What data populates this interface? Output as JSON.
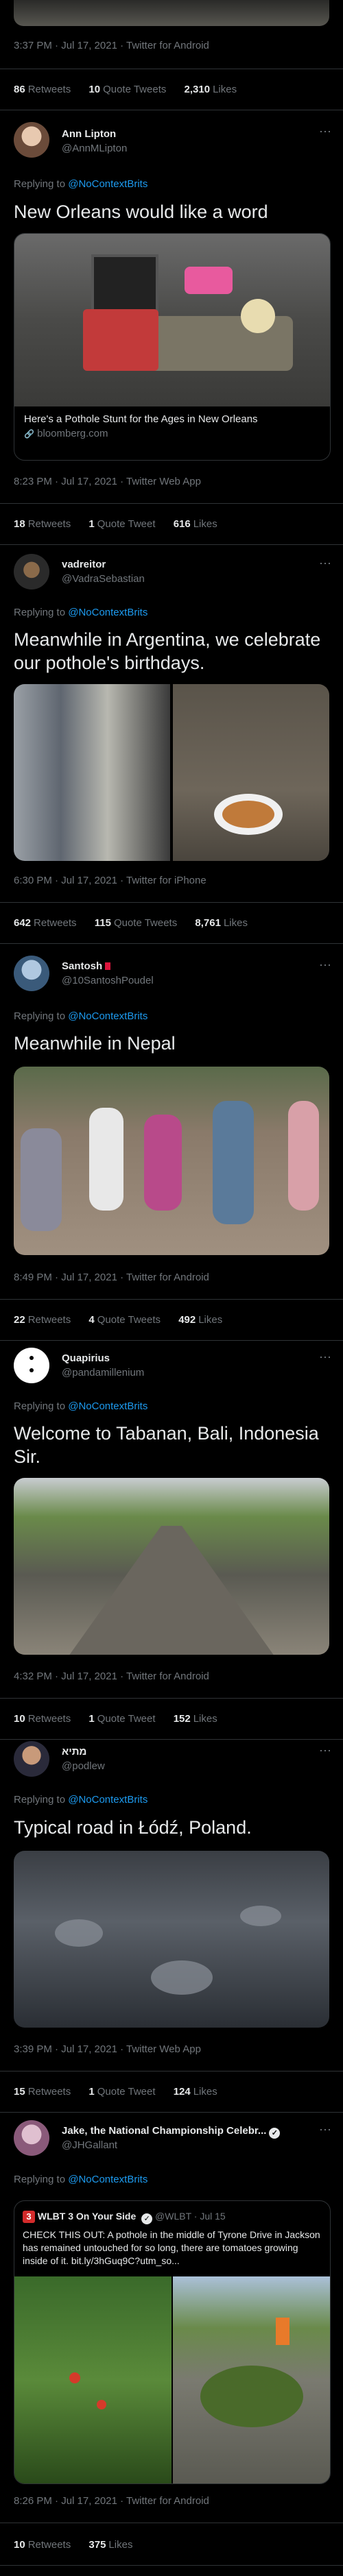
{
  "tweets_top": {
    "meta": "3:37 PM · Jul 17, 2021 · Twitter for Android",
    "retweets": "86",
    "retweets_label": "Retweets",
    "quotes": "10",
    "quotes_label": "Quote Tweets",
    "likes": "2,310",
    "likes_label": "Likes"
  },
  "tweet1": {
    "name": "Ann Lipton",
    "handle": "@AnnMLipton",
    "reply_prefix": "Replying to ",
    "reply_to": "@NoContextBrits",
    "text": "New Orleans would like a word",
    "card_title": "Here's a Pothole Stunt for the Ages in New Orleans",
    "card_domain": "bloomberg.com",
    "meta": "8:23 PM · Jul 17, 2021 · Twitter Web App",
    "retweets": "18",
    "quotes": "1",
    "quotes_label": "Quote Tweet",
    "likes": "616",
    "retweets_label": "Retweets",
    "likes_label": "Likes"
  },
  "tweet2": {
    "name": "vadreitor",
    "handle": "@VadraSebastian",
    "reply_prefix": "Replying to ",
    "reply_to": "@NoContextBrits",
    "text": "Meanwhile in Argentina, we celebrate our pothole's birthdays.",
    "meta": "6:30 PM · Jul 17, 2021 · Twitter for iPhone",
    "retweets": "642",
    "quotes": "115",
    "quotes_label": "Quote Tweets",
    "likes": "8,761",
    "retweets_label": "Retweets",
    "likes_label": "Likes"
  },
  "tweet3": {
    "name": "Santosh",
    "handle": "@10SantoshPoudel",
    "reply_prefix": "Replying to ",
    "reply_to": "@NoContextBrits",
    "text": "Meanwhile in Nepal",
    "meta": "8:49 PM · Jul 17, 2021 · Twitter for Android",
    "retweets": "22",
    "quotes": "4",
    "quotes_label": "Quote Tweets",
    "likes": "492",
    "retweets_label": "Retweets",
    "likes_label": "Likes"
  },
  "tweet4": {
    "name": "Quapirius",
    "handle": "@pandamillenium",
    "reply_prefix": "Replying to ",
    "reply_to": "@NoContextBrits",
    "text": "Welcome to Tabanan,  Bali, Indonesia Sir.",
    "meta": "4:32 PM · Jul 17, 2021 · Twitter for Android",
    "retweets": "10",
    "quotes": "1",
    "quotes_label": "Quote Tweet",
    "likes": "152",
    "retweets_label": "Retweets",
    "likes_label": "Likes"
  },
  "tweet5": {
    "name": "מתיא",
    "handle": "@podlew",
    "reply_prefix": "Replying to ",
    "reply_to": "@NoContextBrits",
    "text": "Typical road in Łódź, Poland.",
    "meta": "3:39 PM · Jul 17, 2021 · Twitter Web App",
    "retweets": "15",
    "quotes": "1",
    "quotes_label": "Quote Tweet",
    "likes": "124",
    "retweets_label": "Retweets",
    "likes_label": "Likes"
  },
  "tweet6": {
    "name": "Jake, the National Championship Celebr...",
    "handle": "@JHGallant",
    "reply_prefix": "Replying to ",
    "reply_to": "@NoContextBrits",
    "quote_badge": "3",
    "quote_name": "WLBT 3 On Your Side",
    "quote_handle_date": "@WLBT · Jul 15",
    "quote_text": "CHECK THIS OUT: A pothole in the middle of Tyrone Drive in Jackson has remained untouched for so long, there are tomatoes growing inside of it. bit.ly/3hGuq9C?utm_so...",
    "meta": "8:26 PM · Jul 17, 2021 · Twitter for Android",
    "retweets": "10",
    "likes": "375",
    "retweets_label": "Retweets",
    "likes_label": "Likes"
  },
  "icons": {
    "more": "⋯",
    "link": "🔗",
    "verified": "✓"
  },
  "colors": {
    "accent": "#1d9bf0",
    "muted": "#71767b",
    "text": "#e7e9ea",
    "border": "#2f3336"
  }
}
